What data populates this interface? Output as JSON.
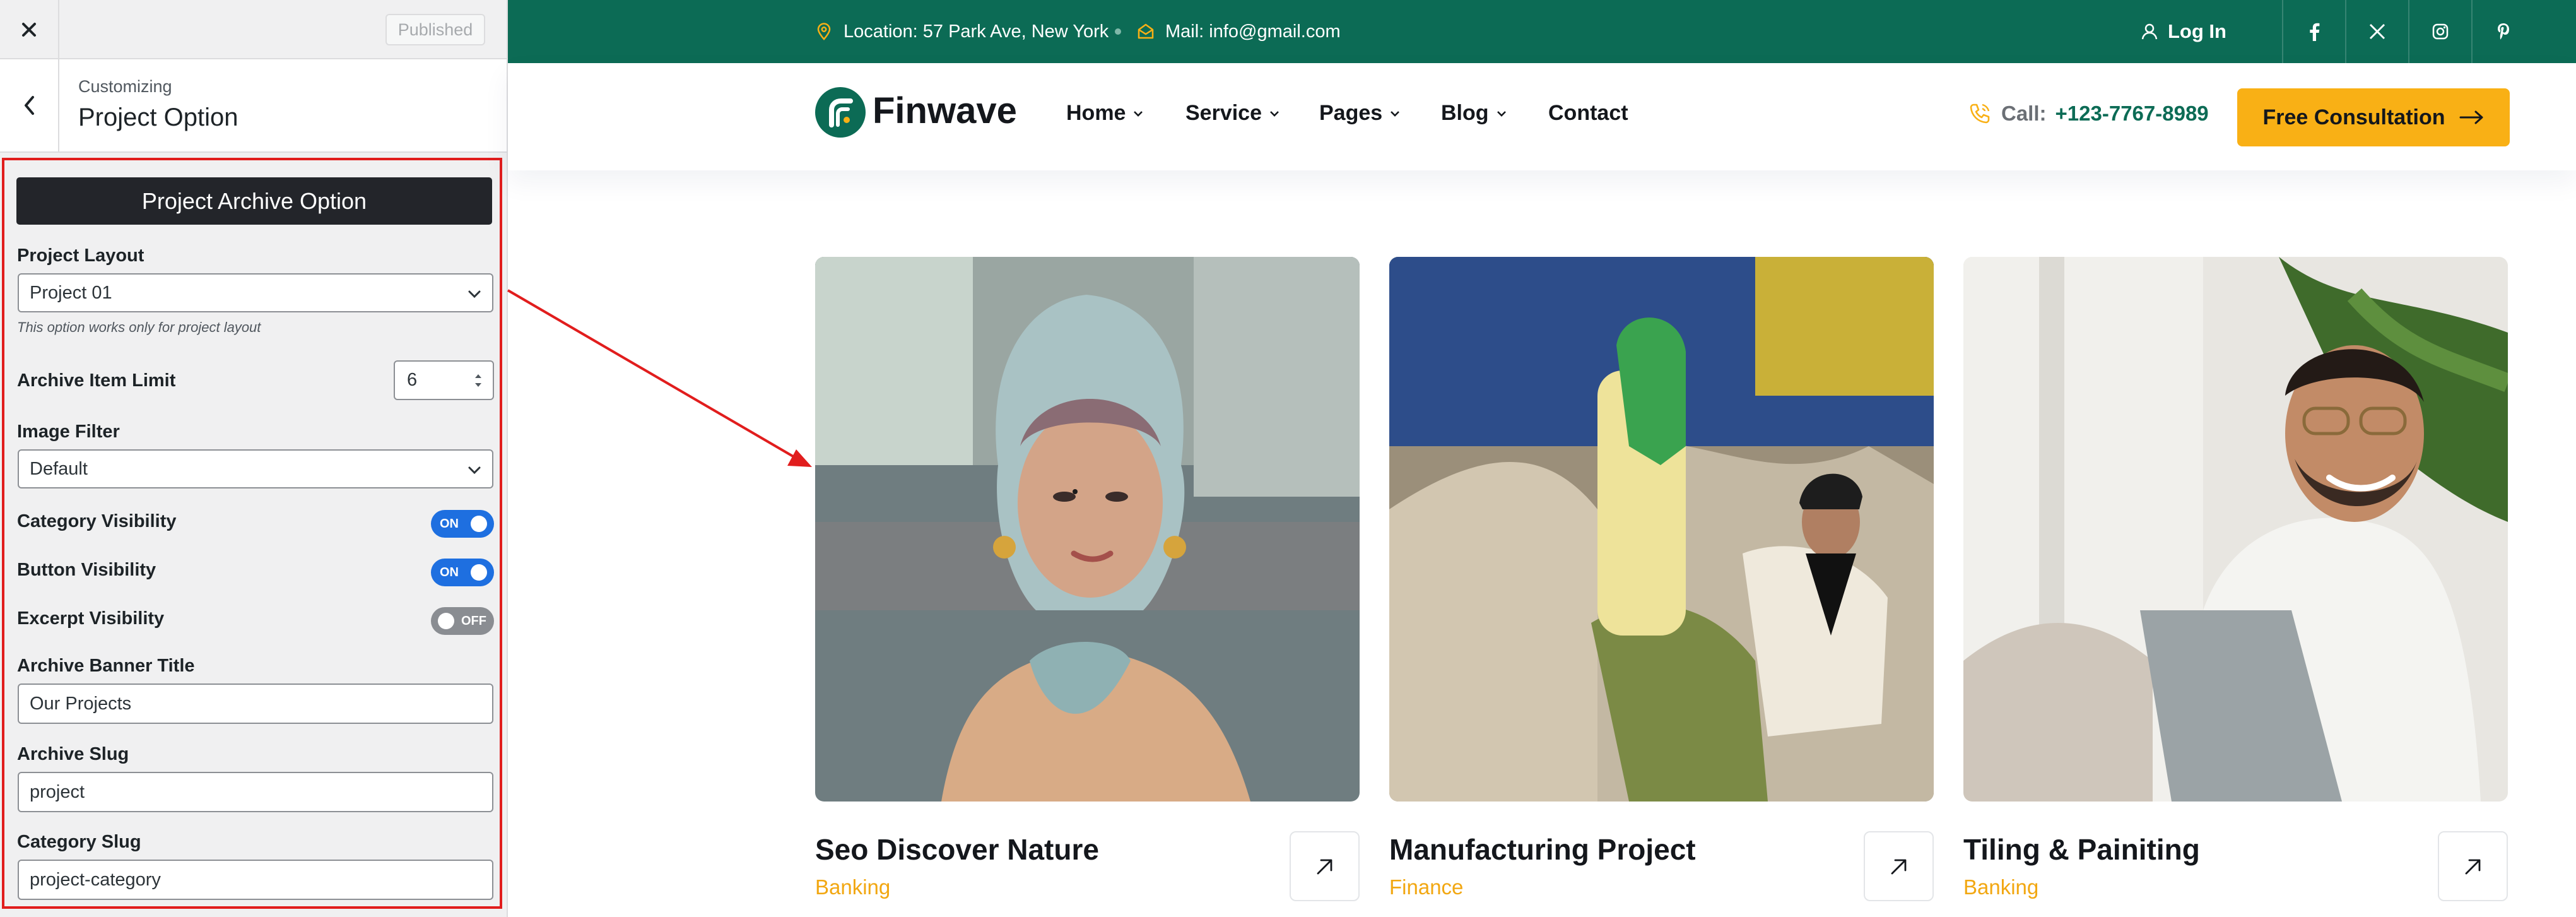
{
  "customizer": {
    "publish_label": "Published",
    "breadcrumb": "Customizing",
    "section_title": "Project Option",
    "banner": "Project Archive Option",
    "project_layout": {
      "label": "Project Layout",
      "value": "Project 01",
      "note": "This option works only for project layout"
    },
    "archive_item_limit": {
      "label": "Archive Item Limit",
      "value": "6"
    },
    "image_filter": {
      "label": "Image Filter",
      "value": "Default"
    },
    "category_visibility": {
      "label": "Category Visibility",
      "state": "ON"
    },
    "button_visibility": {
      "label": "Button Visibility",
      "state": "ON"
    },
    "excerpt_visibility": {
      "label": "Excerpt Visibility",
      "state": "OFF"
    },
    "archive_banner_title": {
      "label": "Archive Banner Title",
      "value": "Our Projects"
    },
    "archive_slug": {
      "label": "Archive Slug",
      "value": "project"
    },
    "category_slug": {
      "label": "Category Slug",
      "value": "project-category"
    },
    "highlight_color": "#e11d1d",
    "toggle_on_color": "#1e6fe0"
  },
  "site": {
    "topbar": {
      "location": "Location: 57 Park Ave, New York",
      "mail": "Mail: info@gmail.com",
      "login": "Log In",
      "social_icons": [
        "facebook-icon",
        "x-icon",
        "instagram-icon",
        "pinterest-icon"
      ]
    },
    "logo": "Finwave",
    "nav": [
      "Home",
      "Service",
      "Pages",
      "Blog",
      "Contact"
    ],
    "call_label": "Call:",
    "call_number": "+123-7767-8989",
    "cta": "Free Consultation",
    "brand_color": "#0c6b55",
    "accent_color": "#f9b015",
    "projects": [
      {
        "title": "Seo Discover Nature",
        "category": "Banking"
      },
      {
        "title": "Manufacturing Project",
        "category": "Finance"
      },
      {
        "title": "Tiling & Painiting",
        "category": "Banking"
      }
    ]
  }
}
